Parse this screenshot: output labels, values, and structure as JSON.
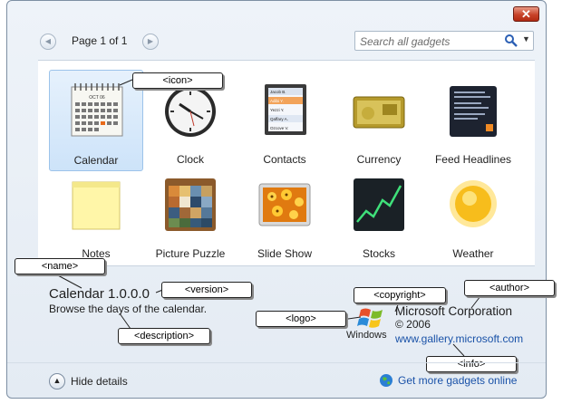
{
  "window": {
    "close_glyph": "✕"
  },
  "nav": {
    "page_label": "Page 1 of 1",
    "prev_icon": "◀",
    "next_icon": "▶"
  },
  "search": {
    "placeholder": "Search all gadgets",
    "dropdown_icon": "▼"
  },
  "gadgets": [
    {
      "label": "Calendar",
      "icon": "calendar-icon",
      "selected": true
    },
    {
      "label": "Clock",
      "icon": "clock-icon"
    },
    {
      "label": "Contacts",
      "icon": "contacts-icon"
    },
    {
      "label": "Currency",
      "icon": "currency-icon"
    },
    {
      "label": "Feed Headlines",
      "icon": "feed-headlines-icon"
    },
    {
      "label": "Notes",
      "icon": "notes-icon"
    },
    {
      "label": "Picture Puzzle",
      "icon": "picture-puzzle-icon"
    },
    {
      "label": "Slide Show",
      "icon": "slide-show-icon"
    },
    {
      "label": "Stocks",
      "icon": "stocks-icon"
    },
    {
      "label": "Weather",
      "icon": "weather-icon"
    }
  ],
  "calendar_icon_text": {
    "month": "OCT 06"
  },
  "contacts_icon_text": [
    "Jacob B.",
    "Adibi Y.",
    "Yezzi Y.",
    "Qaffary A.",
    "Ozcove V."
  ],
  "details": {
    "name": "Calendar 1.0.0.0",
    "description": "Browse the days of the calendar.",
    "author": "Microsoft Corporation",
    "copyright": "© 2006",
    "url": "www.gallery.microsoft.com",
    "logo_text": "Windows"
  },
  "callouts": {
    "icon": "<icon>",
    "name": "<name>",
    "version": "<version>",
    "description": "<description>",
    "logo": "<logo>",
    "copyright": "<copyright>",
    "author": "<author>",
    "info": "<info>"
  },
  "footer": {
    "hide_details": "Hide details",
    "get_more": "Get more gadgets online"
  },
  "colors": {
    "link": "#1a52a8",
    "selection": "#cde3f9",
    "close": "#c8432a"
  }
}
